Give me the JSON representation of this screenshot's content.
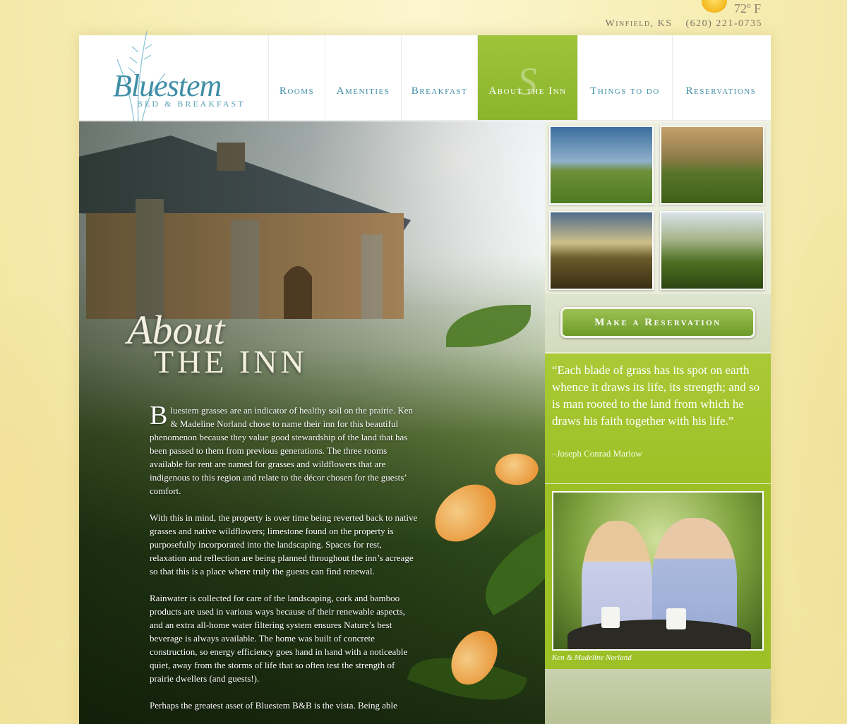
{
  "weather": {
    "temperature": "72º F",
    "icon": "sun-icon"
  },
  "contact": {
    "city": "Winfield, KS",
    "phone": "(620) 221-0735"
  },
  "logo": {
    "name": "Bluestem",
    "subtitle": "BED & BREAKFAST",
    "icon": "grass-icon"
  },
  "nav": {
    "items": [
      {
        "label": "Rooms"
      },
      {
        "label": "Amenities"
      },
      {
        "label": "Breakfast"
      },
      {
        "label": "About the Inn"
      },
      {
        "label": "Things to do"
      },
      {
        "label": "Reservations"
      }
    ],
    "active_index": 3
  },
  "hero": {
    "title_script": "About",
    "title_caps": "THE INN",
    "dropcap": "B",
    "paragraphs": [
      "luestem grasses are an indicator of healthy soil on the prairie. Ken & Madeline Norland chose to name their inn for this beautiful phenomenon because they value good stewardship of the land that has been passed to them from previous generations. The three rooms available for rent are named for grasses and wildflowers that are indigenous to this region and relate to the décor chosen for the guests’ comfort.",
      "With this in mind, the property is over time being reverted back to native grasses and native wildflowers; limestone found on the property is purposefully incorporated into the landscaping. Spaces for rest, relaxation and reflection are being planned throughout the inn’s acreage so that this is a place where truly the guests can find renewal.",
      "Rainwater is collected for care of the landscaping, cork and bamboo products are used in various ways because of their renewable aspects, and an extra all-home water filtering system ensures Nature’s best beverage is always available. The home was built of concrete construction, so energy efficiency goes hand in hand with a noticeable quiet, away from the storms of life that so often test the strength of prairie dwellers (and guests!).",
      "Perhaps the greatest asset of Bluestem B&B is the vista. Being able"
    ]
  },
  "sidebar": {
    "reserve_button": "Make a Reservation",
    "quote": "“Each blade of grass has its spot on earth whence it draws its life, its strength; and so is man rooted to the land from which he draws his faith together with his life.”",
    "quote_author": "–Joseph Conrad Marlow",
    "owners_caption": "Ken & Madeline Norland"
  },
  "colors": {
    "accent_green": "#9dc026",
    "brand_blue": "#3f8ea6",
    "page_bg": "#f7eeb5"
  }
}
